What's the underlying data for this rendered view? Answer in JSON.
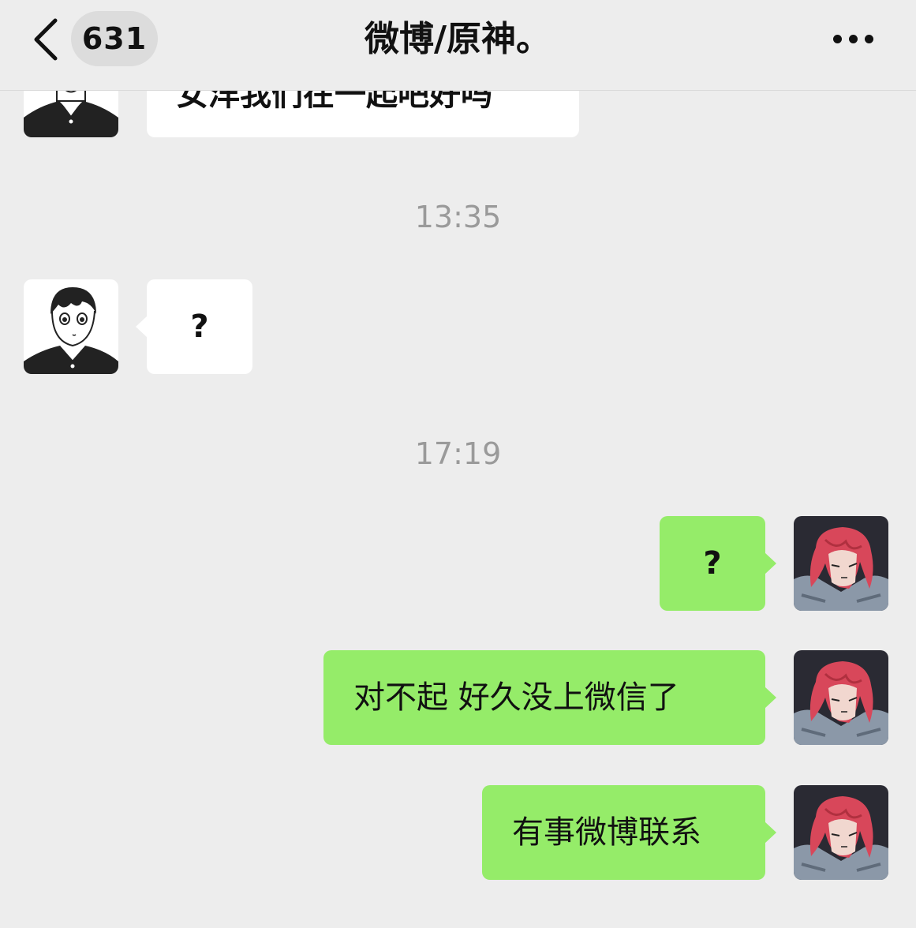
{
  "header": {
    "unread_count": "631",
    "title": "微博/原神。"
  },
  "messages": [
    {
      "side": "in",
      "text": "女洋我们在一起吧好吗",
      "partial": true
    },
    {
      "type": "time",
      "text": "13:35"
    },
    {
      "side": "in",
      "text": "?"
    },
    {
      "type": "time",
      "text": "17:19"
    },
    {
      "side": "out",
      "text": "?"
    },
    {
      "side": "out",
      "text": "对不起 好久没上微信了"
    },
    {
      "side": "out",
      "text": "有事微博联系"
    }
  ],
  "colors": {
    "background": "#ededed",
    "incoming_bubble": "#ffffff",
    "outgoing_bubble": "#95ec69",
    "timestamp_text": "#9a9a9a"
  },
  "icons": [
    "back-chevron-icon",
    "more-dots-icon"
  ]
}
